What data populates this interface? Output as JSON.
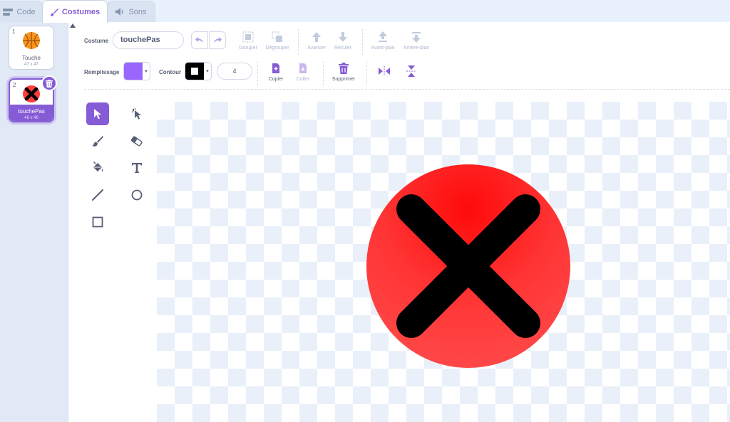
{
  "tabs": {
    "code": "Code",
    "costumes": "Costumes",
    "sounds": "Sons"
  },
  "costumes": [
    {
      "index": "1",
      "name": "Touche",
      "size": "47 x 47"
    },
    {
      "index": "2",
      "name": "touchePas",
      "size": "46 x 46"
    }
  ],
  "toolbar": {
    "costume_label": "Costume",
    "costume_name": "touchePas",
    "group": "Grouper",
    "ungroup": "Dégrouper",
    "forward": "Avancer",
    "backward": "Reculer",
    "front": "Avant-plan",
    "back": "Arrière-plan",
    "fill_label": "Remplissage",
    "outline_label": "Contour",
    "outline_width": "4",
    "copy": "Copier",
    "paste": "Coller",
    "delete": "Supprimer"
  },
  "colors": {
    "accent": "#855cd6",
    "fill": "#9966ff",
    "outline": "#000000",
    "sprite_red": "#ff2e2e",
    "orange": "#f7931e"
  },
  "tools": [
    "select",
    "reshape",
    "brush",
    "eraser",
    "fill",
    "text",
    "line",
    "circle",
    "rectangle"
  ]
}
